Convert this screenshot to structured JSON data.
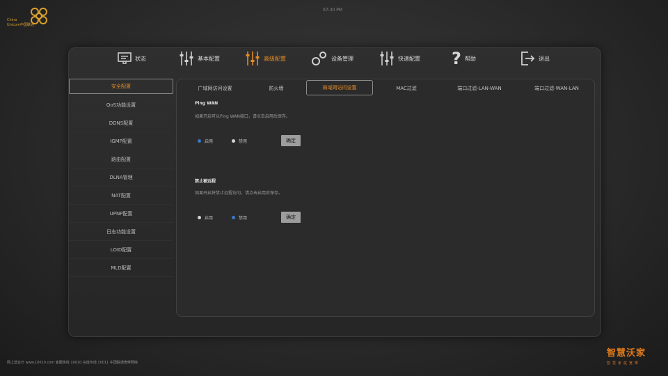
{
  "logo": {
    "line1": "China",
    "line2": "Unicom中国联通",
    "color": "#d9a02e"
  },
  "top_text": "07:30 PM",
  "nav": [
    {
      "label": "状态",
      "icon": "monitor-icon"
    },
    {
      "label": "基本配置",
      "icon": "sliders-icon"
    },
    {
      "label": "高级配置",
      "icon": "sliders-icon",
      "active": true
    },
    {
      "label": "设备管理",
      "icon": "gears-icon"
    },
    {
      "label": "快速配置",
      "icon": "sliders-icon"
    },
    {
      "label": "帮助",
      "icon": "question-icon"
    },
    {
      "label": "退出",
      "icon": "exit-icon"
    }
  ],
  "sidebar": [
    "安全配置",
    "QoS功能设置",
    "DDNS配置",
    "IGMP配置",
    "路由配置",
    "DLNA管理",
    "NAT配置",
    "UPNP配置",
    "日志功能设置",
    "LOID配置",
    "MLD配置"
  ],
  "tabs": [
    "广域网访问设置",
    "防火墙",
    "局域网访问设置",
    "MAC过滤",
    "端口过滤-LAN-WAN",
    "端口过滤-WAN-LAN"
  ],
  "sections": [
    {
      "title": "Ping WAN",
      "desc": "如果开启可以Ping WAN接口，请点击启用后保存。",
      "options": [
        "启用",
        "禁用"
      ],
      "selected": 0,
      "button": "确定"
    },
    {
      "title": "禁止被远程",
      "desc": "如果开启将禁止远程访问，请点击启用后保存。",
      "options": [
        "启用",
        "禁用"
      ],
      "selected": 1,
      "button": "确定"
    }
  ],
  "footer": "网上营业厅 www.10010.com 客服热线 10010 充值专线 10011 中国联通宽带网络",
  "brand": {
    "title": "智慧沃家",
    "sub": "智慧家庭宽带"
  },
  "colors": {
    "accent": "#e48c2a",
    "radio_on": "#3b78c8"
  }
}
